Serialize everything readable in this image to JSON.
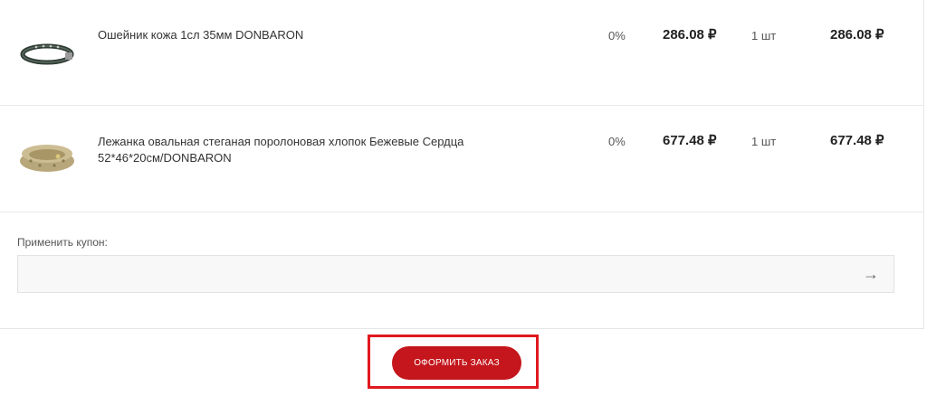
{
  "items": [
    {
      "name": "Ошейник кожа 1сл 35мм DONBARON",
      "discount": "0%",
      "price": "286.08 ₽",
      "qty": "1 шт",
      "total": "286.08 ₽",
      "image_icon": "collar-icon"
    },
    {
      "name": "Лежанка овальная стеганая поролоновая хлопок Бежевые Сердца 52*46*20см/DONBARON",
      "discount": "0%",
      "price": "677.48 ₽",
      "qty": "1 шт",
      "total": "677.48 ₽",
      "image_icon": "pet-bed-icon"
    }
  ],
  "coupon": {
    "label": "Применить купон:",
    "value": "",
    "submit_icon": "arrow-right-icon",
    "submit_glyph": "→"
  },
  "checkout": {
    "button_label": "ОФОРМИТЬ ЗАКАЗ",
    "button_color": "#c4161c",
    "highlight_color": "#e0191f"
  }
}
